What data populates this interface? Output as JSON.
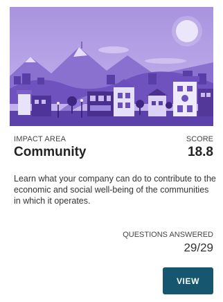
{
  "card": {
    "impact_area_label": "IMPACT AREA",
    "title": "Community",
    "score_label": "SCORE",
    "score_value": "18.8",
    "description": "Learn what your company can do to contribute to the economic and social well-being of the communities in which it operates.",
    "questions_label": "QUESTIONS ANSWERED",
    "questions_value": "29/29",
    "view_label": "VIEW"
  },
  "colors": {
    "accent_button": "#16566e",
    "illustration_light": "#ab97e0",
    "illustration_dark": "#4a2f8c"
  },
  "illustration": "community-town-illustration"
}
